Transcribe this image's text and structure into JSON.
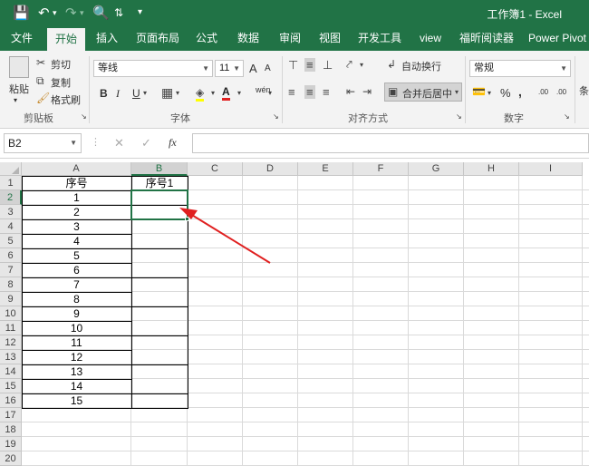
{
  "window": {
    "title": "工作簿1 - Excel",
    "quick_access": {
      "save_icon": "save-icon",
      "undo_icon": "undo-icon",
      "redo_icon": "redo-icon",
      "print_preview_icon": "print-preview-icon",
      "sort_icon": "sort-icon",
      "customize_icon": "customize-icon"
    }
  },
  "tabs": [
    {
      "label": "文件"
    },
    {
      "label": "开始",
      "active": true
    },
    {
      "label": "插入"
    },
    {
      "label": "页面布局"
    },
    {
      "label": "公式"
    },
    {
      "label": "数据"
    },
    {
      "label": "审阅"
    },
    {
      "label": "视图"
    },
    {
      "label": "开发工具"
    },
    {
      "label": "view"
    },
    {
      "label": "福昕阅读器"
    },
    {
      "label": "Power Pivot"
    }
  ],
  "ribbon": {
    "clipboard": {
      "paste": "粘贴",
      "cut": "剪切",
      "copy": "复制",
      "format_painter": "格式刷",
      "group": "剪贴板"
    },
    "font": {
      "name": "等线",
      "size": "11",
      "bold": "B",
      "italic": "I",
      "underline": "U",
      "grow": "A",
      "shrink": "A",
      "phonetic": "wén",
      "group": "字体"
    },
    "alignment": {
      "wrap": "自动换行",
      "merge": "合并后居中",
      "group": "对齐方式"
    },
    "number": {
      "format": "常规",
      "percent": "%",
      "comma": ",",
      "inc_decimal": ".00",
      "dec_decimal": ".00",
      "group": "数字"
    },
    "extra": "条"
  },
  "formula_bar": {
    "name_box": "B2",
    "cancel": "✕",
    "enter": "✓",
    "fx": "fx",
    "content": ""
  },
  "sheet": {
    "columns": [
      "A",
      "B",
      "C",
      "D",
      "E",
      "F",
      "G",
      "H",
      "I"
    ],
    "rows": [
      "1",
      "2",
      "3",
      "4",
      "5",
      "6",
      "7",
      "8",
      "9",
      "10",
      "11",
      "12",
      "13",
      "14",
      "15",
      "16",
      "17",
      "18",
      "19",
      "20"
    ],
    "A": [
      "序号",
      "1",
      "2",
      "3",
      "4",
      "5",
      "6",
      "7",
      "8",
      "9",
      "10",
      "11",
      "12",
      "13",
      "14",
      "15"
    ],
    "B1": "序号1",
    "selected_cell": "B2"
  }
}
